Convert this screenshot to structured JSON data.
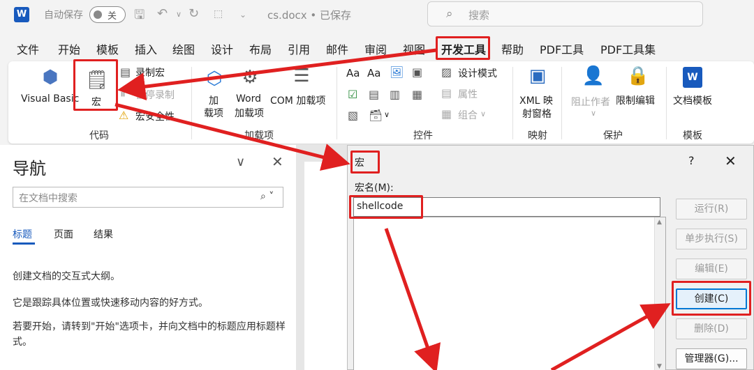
{
  "titlebar": {
    "app_logo": "W",
    "autosave_label": "自动保存",
    "autosave_state": "关",
    "doc_title": "cs.docx • 已保存",
    "search_placeholder": "搜索"
  },
  "tabs": [
    "文件",
    "开始",
    "模板",
    "插入",
    "绘图",
    "设计",
    "布局",
    "引用",
    "邮件",
    "审阅",
    "视图",
    "开发工具",
    "帮助",
    "PDF工具",
    "PDF工具集"
  ],
  "ribbon": {
    "code": {
      "visual_basic": "Visual Basic",
      "macro": "宏",
      "record_macro": "录制宏",
      "pause_recording": "暂停录制",
      "macro_security": "宏安全性",
      "group": "代码"
    },
    "addins": {
      "add_line1": "加",
      "add_line2": "载项",
      "word_line1": "Word",
      "word_line2": "加载项",
      "com": "COM 加载项",
      "group": "加载项"
    },
    "controls": {
      "design_mode": "设计模式",
      "properties": "属性",
      "group_cmd": "组合",
      "group": "控件"
    },
    "mapping": {
      "xml_line1": "XML 映",
      "xml_line2": "射窗格",
      "group": "映射"
    },
    "protect": {
      "block_authors": "阻止作者",
      "restrict_editing": "限制编辑",
      "group": "保护"
    },
    "templates": {
      "doc_template": "文档模板",
      "group": "模板"
    }
  },
  "nav": {
    "title": "导航",
    "search_placeholder": "在文档中搜索",
    "tabs": [
      "标题",
      "页面",
      "结果"
    ],
    "p1": "创建文档的交互式大纲。",
    "p2": "它是跟踪具体位置或快速移动内容的好方式。",
    "p3": "若要开始，请转到\"开始\"选项卡，并向文档中的标题应用标题样式。"
  },
  "dialog": {
    "title": "宏",
    "help": "?",
    "macro_name_label": "宏名(M):",
    "macro_name_value": "shellcode",
    "buttons": {
      "run": "运行(R)",
      "step": "单步执行(S)",
      "edit": "编辑(E)",
      "create": "创建(C)",
      "delete": "删除(D)",
      "organizer": "管理器(G)..."
    }
  },
  "colors": {
    "accent": "#185abd",
    "highlight": "#e02020",
    "focus": "#0078d4"
  }
}
